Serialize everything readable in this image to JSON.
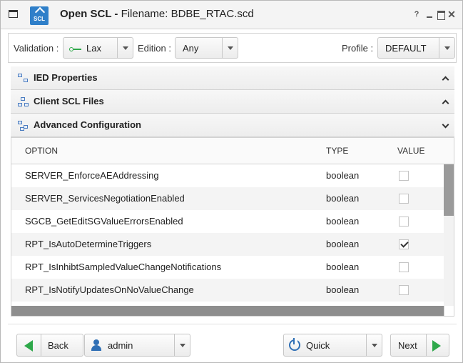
{
  "titlebar": {
    "title_bold": "Open SCL - ",
    "title_rest": "Filename: BDBE_RTAC.scd",
    "logo_text": "SCL",
    "help": "?",
    "close": "✕"
  },
  "controls": {
    "validation_label": "Validation :",
    "validation_value": "Lax",
    "edition_label": "Edition :",
    "edition_value": "Any",
    "profile_label": "Profile :",
    "profile_value": "DEFAULT"
  },
  "sections": [
    {
      "title": "IED Properties",
      "state": "collapsed"
    },
    {
      "title": "Client SCL Files",
      "state": "collapsed"
    },
    {
      "title": "Advanced Configuration",
      "state": "expanded"
    }
  ],
  "table": {
    "columns": [
      "OPTION",
      "TYPE",
      "VALUE"
    ],
    "rows": [
      {
        "option": "SERVER_EnforceAEAddressing",
        "type": "boolean",
        "checked": false
      },
      {
        "option": "SERVER_ServicesNegotiationEnabled",
        "type": "boolean",
        "checked": false
      },
      {
        "option": "SGCB_GetEditSGValueErrorsEnabled",
        "type": "boolean",
        "checked": false
      },
      {
        "option": "RPT_IsAutoDetermineTriggers",
        "type": "boolean",
        "checked": true
      },
      {
        "option": "RPT_IsInhibtSampledValueChangeNotifications",
        "type": "boolean",
        "checked": false
      },
      {
        "option": "RPT_IsNotifyUpdatesOnNoValueChange",
        "type": "boolean",
        "checked": false
      }
    ]
  },
  "footer": {
    "back_label": "Back",
    "user_value": "admin",
    "mode_value": "Quick",
    "next_label": "Next"
  },
  "colors": {
    "accent_green": "#2ea84a",
    "accent_blue": "#2f6fb5"
  }
}
